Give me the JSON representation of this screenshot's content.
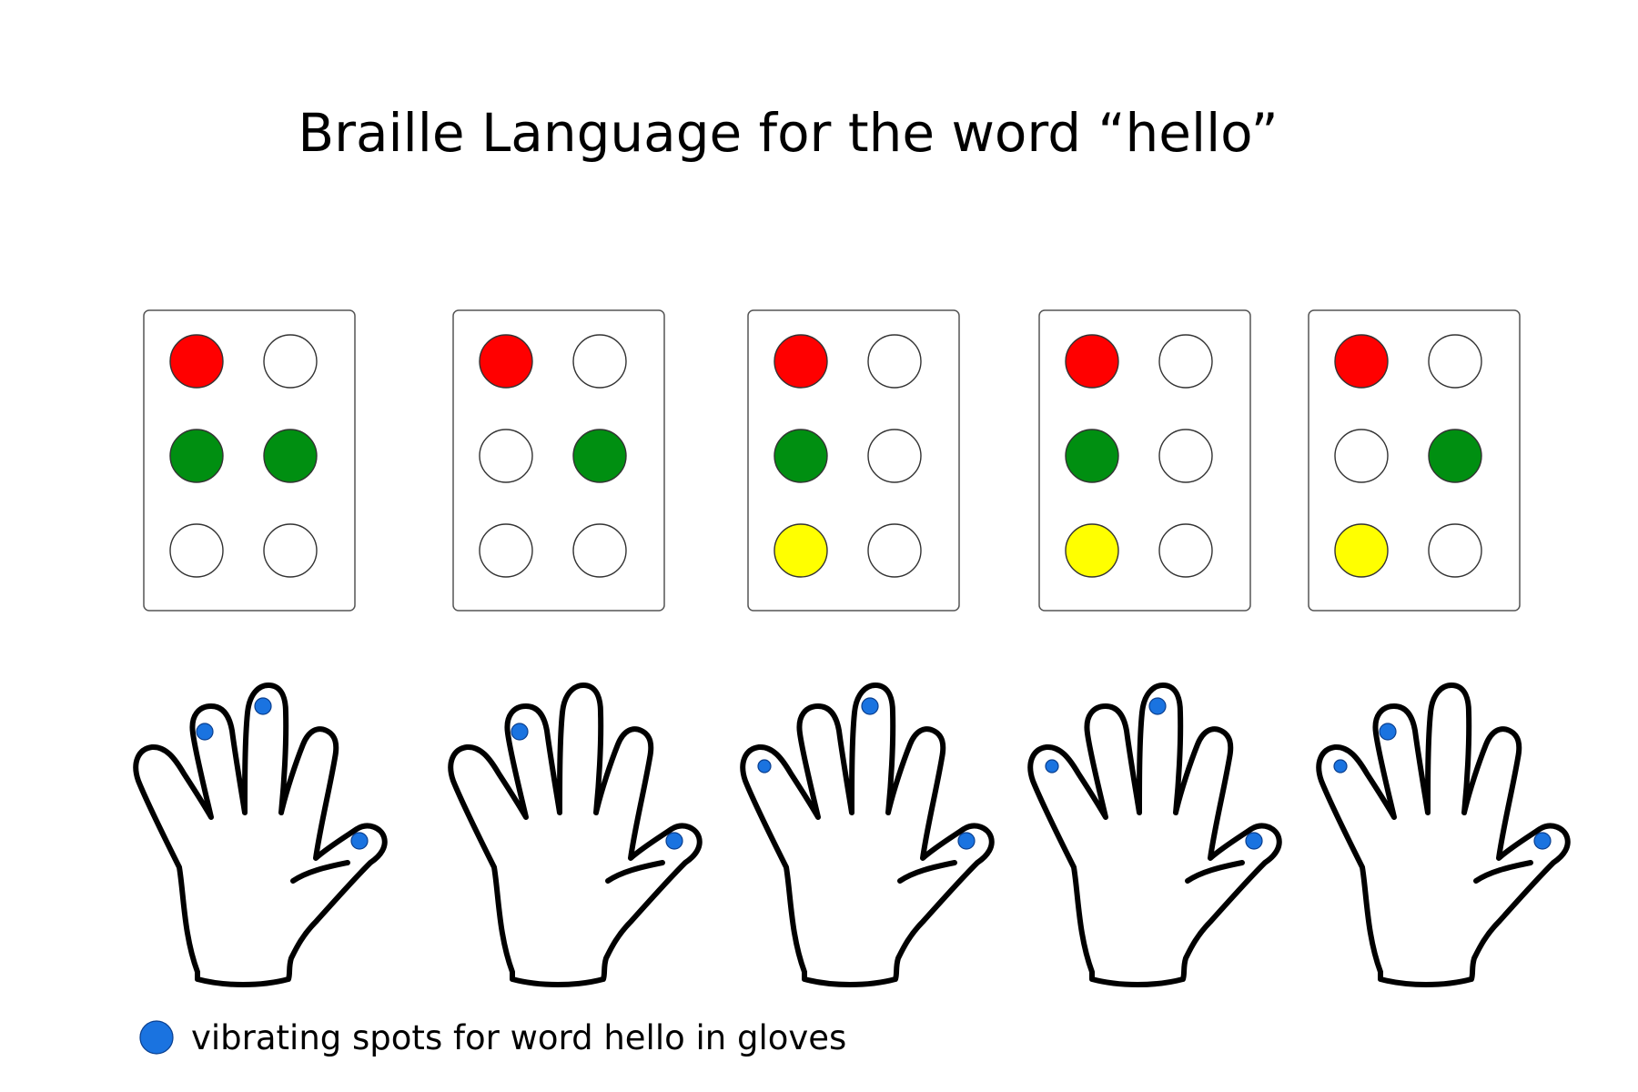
{
  "title": "Braille Language for the word “hello”",
  "legend": {
    "label": "vibrating spots for word hello in gloves"
  },
  "colors": {
    "red": "#ff0000",
    "green": "#008f11",
    "yellow": "#ffff00",
    "empty": "#ffffff",
    "spot": "#1a73e0"
  },
  "braille_cells": [
    {
      "dots": [
        "red",
        "empty",
        "green",
        "green",
        "empty",
        "empty"
      ]
    },
    {
      "dots": [
        "red",
        "empty",
        "empty",
        "green",
        "empty",
        "empty"
      ]
    },
    {
      "dots": [
        "red",
        "empty",
        "green",
        "empty",
        "yellow",
        "empty"
      ]
    },
    {
      "dots": [
        "red",
        "empty",
        "green",
        "empty",
        "yellow",
        "empty"
      ]
    },
    {
      "dots": [
        "red",
        "empty",
        "empty",
        "green",
        "yellow",
        "empty"
      ]
    }
  ],
  "hands": [
    {
      "spots": [
        "ring-finger",
        "middle-finger",
        "thumb"
      ]
    },
    {
      "spots": [
        "ring-finger",
        "thumb"
      ]
    },
    {
      "spots": [
        "little-finger",
        "middle-finger",
        "thumb"
      ]
    },
    {
      "spots": [
        "little-finger",
        "middle-finger",
        "thumb"
      ]
    },
    {
      "spots": [
        "little-finger",
        "ring-finger",
        "thumb"
      ]
    }
  ]
}
